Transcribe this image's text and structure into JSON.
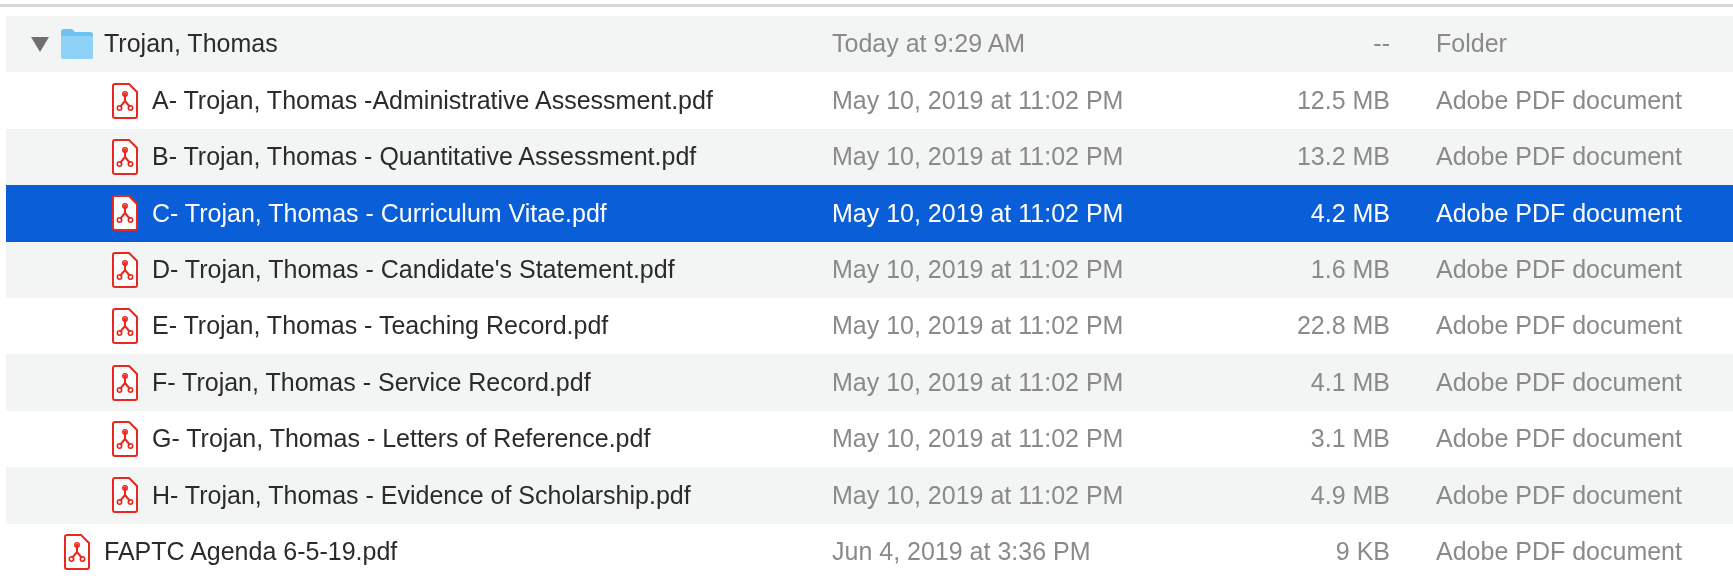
{
  "file_list": [
    {
      "kind": "folder",
      "name": "Trojan, Thomas",
      "date": "Today at 9:29 AM",
      "size": "--",
      "file_type": "Folder",
      "selected": false,
      "expanded": true,
      "children": [
        {
          "kind": "pdf",
          "name": "A- Trojan, Thomas -Administrative Assessment.pdf",
          "date": "May 10, 2019 at 11:02 PM",
          "size": "12.5 MB",
          "file_type": "Adobe PDF document",
          "selected": false
        },
        {
          "kind": "pdf",
          "name": "B- Trojan, Thomas - Quantitative Assessment.pdf",
          "date": "May 10, 2019 at 11:02 PM",
          "size": "13.2 MB",
          "file_type": "Adobe PDF document",
          "selected": false
        },
        {
          "kind": "pdf",
          "name": "C- Trojan, Thomas - Curriculum Vitae.pdf",
          "date": "May 10, 2019 at 11:02 PM",
          "size": "4.2 MB",
          "file_type": "Adobe PDF document",
          "selected": true
        },
        {
          "kind": "pdf",
          "name": "D- Trojan, Thomas - Candidate's Statement.pdf",
          "date": "May 10, 2019 at 11:02 PM",
          "size": "1.6 MB",
          "file_type": "Adobe PDF document",
          "selected": false
        },
        {
          "kind": "pdf",
          "name": "E- Trojan, Thomas - Teaching Record.pdf",
          "date": "May 10, 2019 at 11:02 PM",
          "size": "22.8 MB",
          "file_type": "Adobe PDF document",
          "selected": false
        },
        {
          "kind": "pdf",
          "name": "F- Trojan, Thomas - Service Record.pdf",
          "date": "May 10, 2019 at 11:02 PM",
          "size": "4.1 MB",
          "file_type": "Adobe PDF document",
          "selected": false
        },
        {
          "kind": "pdf",
          "name": "G- Trojan, Thomas - Letters of Reference.pdf",
          "date": "May 10, 2019 at 11:02 PM",
          "size": "3.1 MB",
          "file_type": "Adobe PDF document",
          "selected": false
        },
        {
          "kind": "pdf",
          "name": "H- Trojan, Thomas - Evidence of Scholarship.pdf",
          "date": "May 10, 2019 at 11:02 PM",
          "size": "4.9 MB",
          "file_type": "Adobe PDF document",
          "selected": false
        }
      ]
    },
    {
      "kind": "pdf",
      "name": "FAPTC Agenda 6-5-19.pdf",
      "date": "Jun 4, 2019 at 3:36 PM",
      "size": "9 KB",
      "file_type": "Adobe PDF document",
      "selected": false
    }
  ]
}
